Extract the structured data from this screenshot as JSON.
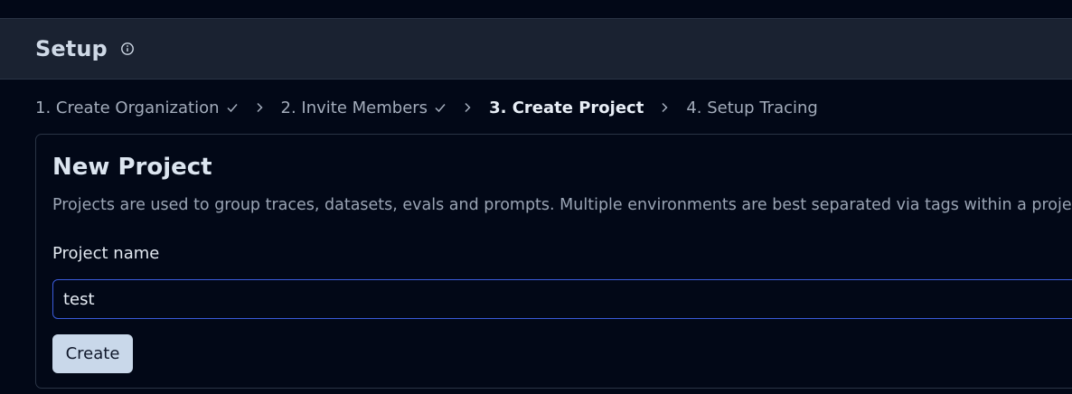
{
  "header": {
    "title": "Setup",
    "info_icon": "info-icon"
  },
  "stepper": {
    "steps": [
      {
        "label": "1. Create Organization",
        "completed": true
      },
      {
        "label": "2. Invite Members",
        "completed": true
      },
      {
        "label": "3. Create Project",
        "active": true
      },
      {
        "label": "4. Setup Tracing",
        "completed": false
      }
    ],
    "separator_icon": "chevron-right-icon",
    "check_icon": "check-icon"
  },
  "card": {
    "title": "New Project",
    "description": "Projects are used to group traces, datasets, evals and prompts. Multiple environments are best separated via tags within a project.",
    "field_label": "Project name",
    "input_value": "test",
    "create_label": "Create"
  },
  "colors": {
    "background": "#020817",
    "header_bg": "#1a2231",
    "border": "#2a3445",
    "input_focus": "#3b5bdb",
    "button_bg": "#c9d8ea"
  }
}
